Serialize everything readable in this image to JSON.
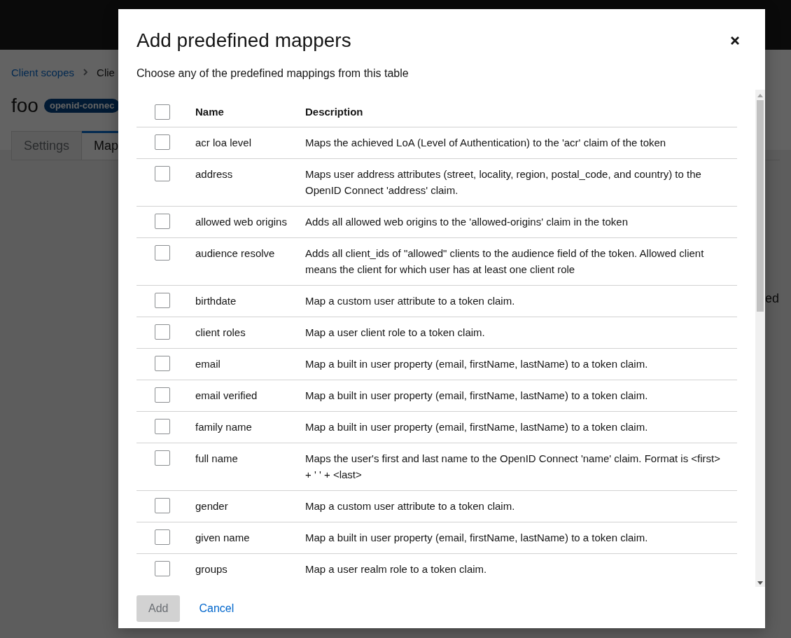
{
  "page": {
    "breadcrumb": [
      {
        "label": "Client scopes",
        "kind": "link"
      },
      {
        "label": "Clie",
        "kind": "current"
      }
    ],
    "title": "foo",
    "badge": "openid-connec",
    "tabs": [
      {
        "label": "Settings",
        "selected": false
      },
      {
        "label": "Map",
        "selected": true
      }
    ],
    "side_text": "ed"
  },
  "modal": {
    "title": "Add predefined mappers",
    "subtitle": "Choose any of the predefined mappings from this table",
    "table": {
      "select_all": {
        "checked": false
      },
      "columns": [
        "Name",
        "Description"
      ],
      "rows": [
        {
          "name": "acr loa level",
          "description": "Maps the achieved LoA (Level of Authentication) to the 'acr' claim of the token",
          "selected": false
        },
        {
          "name": "address",
          "description": "Maps user address attributes (street, locality, region, postal_code, and country) to the OpenID Connect 'address' claim.",
          "selected": false
        },
        {
          "name": "allowed web origins",
          "description": "Adds all allowed web origins to the 'allowed-origins' claim in the token",
          "selected": false
        },
        {
          "name": "audience resolve",
          "description": "Adds all client_ids of \"allowed\" clients to the audience field of the token. Allowed client means the client for which user has at least one client role",
          "selected": false
        },
        {
          "name": "birthdate",
          "description": "Map a custom user attribute to a token claim.",
          "selected": false
        },
        {
          "name": "client roles",
          "description": "Map a user client role to a token claim.",
          "selected": false
        },
        {
          "name": "email",
          "description": "Map a built in user property (email, firstName, lastName) to a token claim.",
          "selected": false
        },
        {
          "name": "email verified",
          "description": "Map a built in user property (email, firstName, lastName) to a token claim.",
          "selected": false
        },
        {
          "name": "family name",
          "description": "Map a built in user property (email, firstName, lastName) to a token claim.",
          "selected": false
        },
        {
          "name": "full name",
          "description": "Maps the user's first and last name to the OpenID Connect 'name' claim. Format is <first> + ' ' + <last>",
          "selected": false
        },
        {
          "name": "gender",
          "description": "Map a custom user attribute to a token claim.",
          "selected": false
        },
        {
          "name": "given name",
          "description": "Map a built in user property (email, firstName, lastName) to a token claim.",
          "selected": false
        },
        {
          "name": "groups",
          "description": "Map a user realm role to a token claim.",
          "selected": false
        }
      ]
    },
    "add_button": {
      "label": "Add",
      "disabled": true
    },
    "cancel_button": {
      "label": "Cancel"
    }
  }
}
